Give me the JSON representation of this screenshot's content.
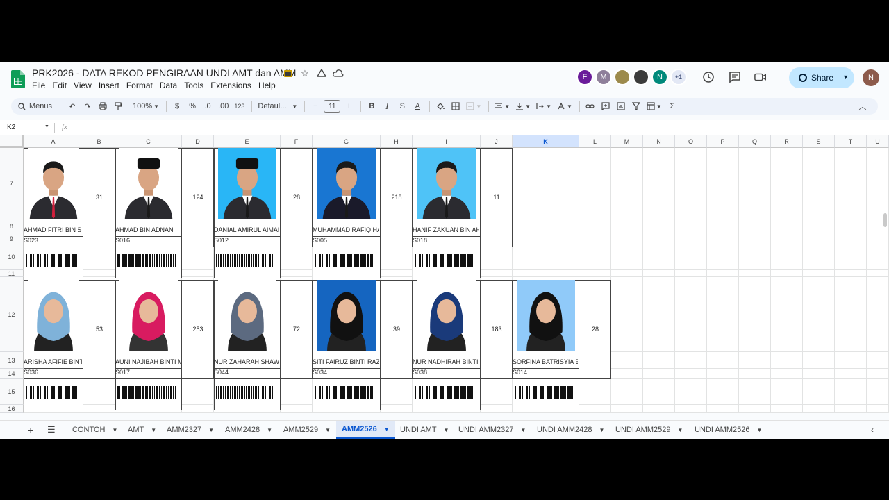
{
  "window": {
    "title": "PRK2026 - DATA REKOD PENGIRAAN UNDI AMT dan AMM",
    "menus": [
      "File",
      "Edit",
      "View",
      "Insert",
      "Format",
      "Data",
      "Tools",
      "Extensions",
      "Help"
    ]
  },
  "collaborators": [
    {
      "initial": "F",
      "color": "#6a1b9a"
    },
    {
      "initial": "M",
      "color": "#8e7f9a"
    },
    {
      "initial": "",
      "color": "#9c8a4c"
    },
    {
      "initial": "",
      "color": "#3b3b3b"
    },
    {
      "initial": "N",
      "color": "#00897b"
    }
  ],
  "collaborators_more": "+1",
  "share_label": "Share",
  "user_initial": "N",
  "toolbar": {
    "menus_label": "Menus",
    "zoom": "100%",
    "currency": "$",
    "percent": "%",
    "dec_decrease": ".0",
    "dec_increase": ".00",
    "number_format": "123",
    "font": "Defaul...",
    "font_size": "11",
    "minus": "−",
    "plus": "+",
    "bold": "B",
    "italic": "I",
    "strike": "S",
    "text_color": "A",
    "sigma": "Σ"
  },
  "formula_bar": {
    "cell_ref": "K2",
    "fx": "fx"
  },
  "columns": [
    "A",
    "B",
    "C",
    "D",
    "E",
    "F",
    "G",
    "H",
    "I",
    "J",
    "K",
    "L",
    "M",
    "N",
    "O",
    "P",
    "Q",
    "R",
    "S",
    "T",
    "U"
  ],
  "selected_column": "K",
  "rows": [
    "7",
    "8",
    "9",
    "10",
    "11",
    "12",
    "13",
    "14",
    "15",
    "16"
  ],
  "candidates_row1": [
    {
      "name": "AHMAD FITRI BIN SHAMSUDIN",
      "code": "S023",
      "count": "31",
      "photo": "male-tie-red",
      "bg": "#ffffff"
    },
    {
      "name": "AHMAD BIN ADNAN",
      "code": "S016",
      "count": "124",
      "photo": "male-songkok",
      "bg": "#ffffff"
    },
    {
      "name": "DANIAL AMIRUL AIMAN",
      "code": "S012",
      "count": "28",
      "photo": "male-songkok-blue",
      "bg": "#29b6f6"
    },
    {
      "name": "MUHAMMAD RAFIQ HAZIQ",
      "code": "S005",
      "count": "218",
      "photo": "male-blue",
      "bg": "#1976d2"
    },
    {
      "name": "HANIF ZAKUAN BIN AHMAD",
      "code": "S018",
      "count": "11",
      "photo": "male-suit",
      "bg": "#4fc3f7"
    }
  ],
  "candidates_row2": [
    {
      "name": "ARISHA AFIFIE BINTI",
      "code": "S036",
      "count": "53",
      "photo": "female-blue",
      "bg": "#ffffff"
    },
    {
      "name": "AUNI NAJIBAH BINTI MOHD",
      "code": "S017",
      "count": "253",
      "photo": "female-pink",
      "bg": "#ffffff"
    },
    {
      "name": "NUR ZAHARAH SHAWAL",
      "code": "S044",
      "count": "72",
      "photo": "female-grey",
      "bg": "#ffffff"
    },
    {
      "name": "SITI FAIRUZ BINTI RAZAK",
      "code": "S034",
      "count": "39",
      "photo": "female-black",
      "bg": "#1565c0"
    },
    {
      "name": "NUR NADHIRAH BINTI",
      "code": "S038",
      "count": "183",
      "photo": "female-navy",
      "bg": "#ffffff"
    },
    {
      "name": "SORFINA BATRISYIA BINTI",
      "code": "S014",
      "count": "28",
      "photo": "female-black-2",
      "bg": "#90caf9"
    }
  ],
  "sheet_tabs": [
    {
      "label": "CONTOH",
      "active": false
    },
    {
      "label": "AMT",
      "active": false
    },
    {
      "label": "AMM2327",
      "active": false
    },
    {
      "label": "AMM2428",
      "active": false
    },
    {
      "label": "AMM2529",
      "active": false
    },
    {
      "label": "AMM2526",
      "active": true
    },
    {
      "label": "UNDI AMT",
      "active": false
    },
    {
      "label": "UNDI AMM2327",
      "active": false
    },
    {
      "label": "UNDI AMM2428",
      "active": false
    },
    {
      "label": "UNDI AMM2529",
      "active": false
    },
    {
      "label": "UNDI AMM2526",
      "active": false
    }
  ]
}
